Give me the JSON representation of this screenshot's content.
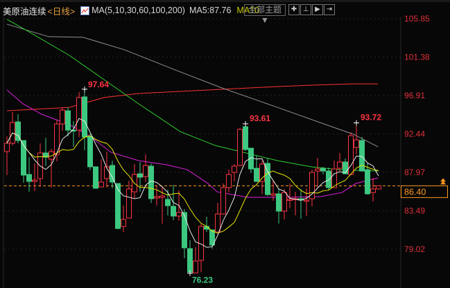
{
  "header": {
    "instrument": "美原油连续",
    "period": "<日线>",
    "ma_params": "MA(5,10,30,60,100,200)",
    "ma5_text": "MA5:87.76",
    "ma10_text": "MA10",
    "theme_button": "全部主题▼",
    "tools": [
      {
        "icon": "crosshair-icon",
        "glyph": "✚"
      },
      {
        "icon": "zoom-range-icon",
        "glyph": "⊥"
      },
      {
        "icon": "play-forward-icon",
        "glyph": "▶"
      },
      {
        "icon": "jump-end-icon",
        "glyph": "⇥"
      }
    ]
  },
  "price_axis": {
    "labels": [
      "105.85",
      "101.38",
      "96.91",
      "92.44",
      "87.97",
      "83.49",
      "79.02"
    ],
    "current_price": "86.40"
  },
  "annotations": {
    "high_1": "97.64",
    "high_2": "93.61",
    "high_3": "93.72",
    "low_1": "76.23"
  },
  "colors": {
    "up": "#ff3344",
    "down": "#3cc880",
    "ma5": "#e8e8e8",
    "ma10": "#e8e800",
    "ma30": "#e020e0",
    "ma60": "#30d030",
    "ma100": "#909090",
    "ma200": "#ff3030",
    "current_line": "#ff9a20"
  },
  "chart_data": {
    "type": "candlestick",
    "ylim": [
      75.5,
      106.2
    ],
    "candles": [
      [
        90.38,
        92.15,
        87.64,
        91.35
      ],
      [
        91.35,
        94.97,
        91.1,
        93.76
      ],
      [
        93.84,
        94.73,
        91.35,
        91.67
      ],
      [
        91.67,
        91.67,
        86.75,
        87.64
      ],
      [
        87.72,
        89.73,
        85.7,
        86.91
      ],
      [
        86.91,
        89.01,
        85.78,
        87.07
      ],
      [
        87.24,
        91.35,
        86.27,
        90.22
      ],
      [
        90.22,
        91.99,
        88.69,
        89.73
      ],
      [
        89.49,
        90.7,
        86.19,
        90.38
      ],
      [
        90.06,
        94.09,
        89.25,
        93.6
      ],
      [
        93.6,
        95.54,
        92.8,
        95.21
      ],
      [
        95.13,
        95.54,
        92.15,
        92.88
      ],
      [
        92.88,
        93.92,
        90.94,
        92.8
      ],
      [
        92.88,
        97.31,
        92.07,
        96.67
      ],
      [
        96.75,
        97.64,
        90.54,
        92.07
      ],
      [
        92.15,
        92.47,
        88.2,
        88.61
      ],
      [
        88.61,
        88.61,
        86.11,
        86.11
      ],
      [
        86.27,
        89.49,
        86.27,
        86.83
      ],
      [
        87.24,
        90.38,
        86.19,
        88.61
      ],
      [
        88.77,
        89.33,
        86.11,
        86.83
      ],
      [
        86.67,
        86.67,
        81.35,
        81.43
      ],
      [
        81.67,
        84.09,
        81.03,
        82.48
      ],
      [
        82.64,
        86.99,
        82.64,
        86.03
      ],
      [
        85.7,
        88.93,
        84.98,
        87.72
      ],
      [
        87.8,
        89.17,
        85.7,
        87.4
      ],
      [
        87.48,
        90.06,
        86.83,
        88.77
      ],
      [
        88.69,
        89.01,
        84.41,
        84.9
      ],
      [
        84.98,
        86.43,
        84.09,
        85.14
      ],
      [
        85.06,
        86.27,
        82.0,
        85.22
      ],
      [
        84.82,
        85.95,
        82.96,
        84.09
      ],
      [
        84.01,
        86.51,
        82.4,
        82.88
      ],
      [
        82.88,
        85.86,
        82.32,
        83.29
      ],
      [
        83.29,
        83.69,
        77.97,
        79.18
      ],
      [
        79.09,
        80.06,
        76.23,
        76.35
      ],
      [
        76.27,
        79.26,
        76.25,
        77.64
      ],
      [
        77.72,
        82.0,
        76.35,
        81.67
      ],
      [
        81.67,
        82.8,
        81.03,
        81.35
      ],
      [
        81.27,
        81.27,
        79.09,
        79.5
      ],
      [
        81.03,
        84.41,
        81.03,
        83.12
      ],
      [
        83.12,
        86.67,
        83.04,
        86.19
      ],
      [
        86.19,
        88.28,
        85.62,
        87.72
      ],
      [
        87.96,
        88.93,
        86.91,
        88.69
      ],
      [
        88.77,
        93.12,
        88.69,
        92.96
      ],
      [
        93.28,
        93.61,
        90.46,
        90.62
      ],
      [
        90.78,
        90.78,
        87.88,
        88.36
      ],
      [
        88.44,
        89.89,
        86.83,
        86.91
      ],
      [
        86.91,
        89.33,
        85.46,
        88.93
      ],
      [
        89.01,
        89.57,
        85.22,
        85.38
      ],
      [
        85.3,
        87.07,
        84.66,
        85.46
      ],
      [
        85.46,
        86.03,
        82.0,
        83.45
      ],
      [
        83.45,
        86.03,
        82.48,
        85.62
      ],
      [
        84.74,
        86.67,
        83.8,
        84.82
      ],
      [
        84.82,
        85.7,
        82.96,
        84.9
      ],
      [
        84.9,
        86.03,
        82.56,
        84.74
      ],
      [
        84.66,
        86.11,
        82.88,
        84.74
      ],
      [
        84.9,
        88.28,
        84.01,
        87.96
      ],
      [
        88.12,
        89.65,
        86.27,
        88.36
      ],
      [
        88.44,
        88.61,
        87.72,
        88.12
      ],
      [
        88.12,
        88.52,
        85.86,
        86.19
      ],
      [
        86.19,
        89.33,
        86.19,
        88.36
      ],
      [
        88.44,
        90.22,
        88.12,
        89.17
      ],
      [
        89.17,
        89.57,
        87.72,
        87.8
      ],
      [
        87.72,
        92.64,
        87.64,
        92.23
      ],
      [
        90.86,
        93.72,
        90.06,
        91.75
      ],
      [
        91.67,
        92.07,
        88.12,
        88.12
      ],
      [
        88.28,
        89.09,
        85.38,
        85.46
      ],
      [
        85.62,
        87.32,
        84.58,
        86.03
      ],
      [
        86.03,
        86.4,
        86.03,
        86.4
      ]
    ],
    "ma_series": {
      "ma30": [
        [
          0,
          97.55
        ],
        [
          2.9,
          95.94
        ],
        [
          6.25,
          94.73
        ],
        [
          11.25,
          93.52
        ],
        [
          15,
          92.15
        ],
        [
          18.75,
          90.3
        ],
        [
          23.75,
          89.33
        ],
        [
          28.75,
          88.85
        ],
        [
          32.5,
          88.28
        ],
        [
          36.25,
          86.67
        ],
        [
          37.9,
          85.7
        ],
        [
          43.4,
          85.06
        ],
        [
          50.4,
          85.06
        ],
        [
          56.6,
          85.14
        ],
        [
          60.4,
          85.62
        ],
        [
          62.9,
          86.67
        ],
        [
          66.9,
          87.32
        ]
      ],
      "ma60": [
        [
          0,
          105.77
        ],
        [
          3.75,
          104.4
        ],
        [
          11.25,
          101.58
        ],
        [
          17.5,
          98.76
        ],
        [
          23.75,
          95.94
        ],
        [
          31.25,
          92.71
        ],
        [
          37.5,
          91.1
        ],
        [
          48.75,
          89.33
        ],
        [
          55,
          88.6
        ],
        [
          60,
          88.28
        ],
        [
          66.9,
          88.12
        ]
      ],
      "ma100": [
        [
          0,
          105.21
        ],
        [
          7.5,
          103.76
        ],
        [
          13.75,
          103.68
        ],
        [
          21.25,
          102.22
        ],
        [
          30,
          99.97
        ],
        [
          38.75,
          97.79
        ],
        [
          48.75,
          95.53
        ],
        [
          57.5,
          93.52
        ],
        [
          62.5,
          92.39
        ],
        [
          66.9,
          90.94
        ]
      ],
      "ma200": [
        [
          0,
          95.13
        ],
        [
          11.25,
          95.53
        ],
        [
          17.5,
          96.67
        ],
        [
          23.75,
          97.15
        ],
        [
          36.25,
          97.55
        ],
        [
          41.25,
          97.71
        ],
        [
          48.75,
          97.95
        ],
        [
          55,
          98.11
        ],
        [
          62.5,
          98.27
        ],
        [
          66.9,
          98.27
        ]
      ]
    },
    "current_price": 86.4
  }
}
